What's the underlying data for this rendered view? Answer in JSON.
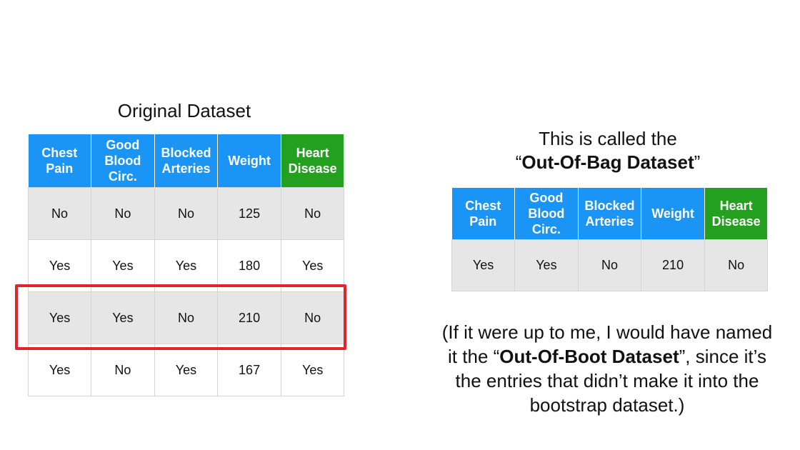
{
  "original": {
    "title": "Original Dataset",
    "headers": [
      "Chest\nPain",
      "Good\nBlood\nCirc.",
      "Blocked\nArteries",
      "Weight",
      "Heart\nDisease"
    ],
    "rows": [
      [
        "No",
        "No",
        "No",
        "125",
        "No"
      ],
      [
        "Yes",
        "Yes",
        "Yes",
        "180",
        "Yes"
      ],
      [
        "Yes",
        "Yes",
        "No",
        "210",
        "No"
      ],
      [
        "Yes",
        "No",
        "Yes",
        "167",
        "Yes"
      ]
    ]
  },
  "oob": {
    "title_line1": "This is called the",
    "title_open_quote": "“",
    "title_bold": "Out-Of-Bag Dataset",
    "title_close_quote": "”",
    "headers": [
      "Chest\nPain",
      "Good\nBlood\nCirc.",
      "Blocked\nArteries",
      "Weight",
      "Heart\nDisease"
    ],
    "rows": [
      [
        "Yes",
        "Yes",
        "No",
        "210",
        "No"
      ]
    ]
  },
  "note": {
    "line1": "(If it were up to me, I would have named",
    "line2_prefix": "it the “",
    "line2_bold": "Out-Of-Boot Dataset",
    "line2_suffix": "”, since it’s",
    "line3": "the entries that didn’t make it into the",
    "line4": "bootstrap dataset.)"
  },
  "colors": {
    "header_blue": "#1b95f5",
    "header_green": "#23a11e",
    "highlight_red": "#e5232a",
    "row_shade": "#e6e6e6"
  }
}
